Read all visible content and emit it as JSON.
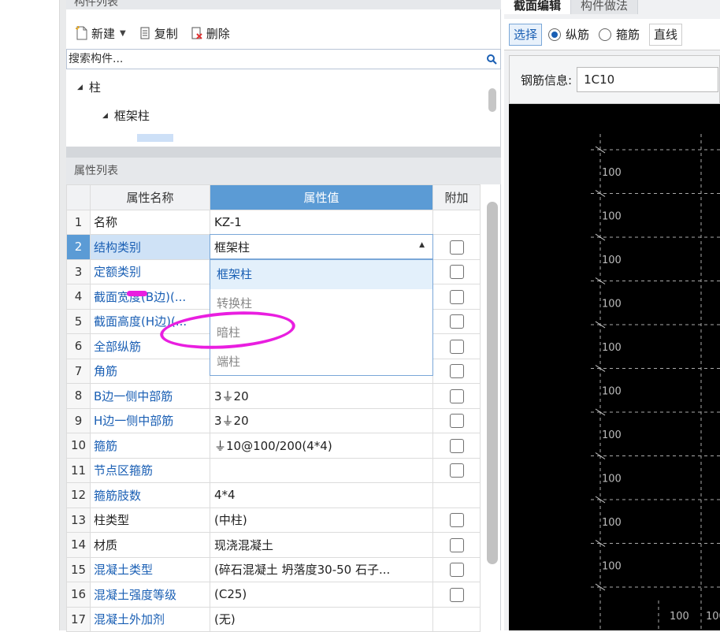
{
  "component_panel": {
    "title": "构件列表",
    "toolbar": {
      "new_label": "新建",
      "copy_label": "复制",
      "delete_label": "删除"
    },
    "search_placeholder": "搜索构件...",
    "tree": [
      {
        "label": "柱"
      },
      {
        "label": "框架柱"
      }
    ]
  },
  "property_panel": {
    "title": "属性列表",
    "headers": {
      "name": "属性名称",
      "value": "属性值",
      "extra": "附加"
    },
    "rows": [
      {
        "idx": "1",
        "name": "名称",
        "value": "KZ-1",
        "check": false
      },
      {
        "idx": "2",
        "name": "结构类别",
        "value": "框架柱",
        "check": true
      },
      {
        "idx": "3",
        "name": "定额类别",
        "value": "",
        "check": true
      },
      {
        "idx": "4",
        "name": "截面宽度(B边)(...",
        "value": "",
        "check": true
      },
      {
        "idx": "5",
        "name": "截面高度(H边)(...",
        "value": "",
        "check": true
      },
      {
        "idx": "6",
        "name": "全部纵筋",
        "value": "",
        "check": true
      },
      {
        "idx": "7",
        "name": "角筋",
        "value": "",
        "check": true
      },
      {
        "idx": "8",
        "name": "B边一侧中部筋",
        "value": "3⏚20",
        "check": true
      },
      {
        "idx": "9",
        "name": "H边一侧中部筋",
        "value": "3⏚20",
        "check": true
      },
      {
        "idx": "10",
        "name": "箍筋",
        "value": "⏚10@100/200(4*4)",
        "check": true
      },
      {
        "idx": "11",
        "name": "节点区箍筋",
        "value": "",
        "check": true
      },
      {
        "idx": "12",
        "name": "箍筋肢数",
        "value": "4*4",
        "check": false
      },
      {
        "idx": "13",
        "name": "柱类型",
        "value": "(中柱)",
        "check": true
      },
      {
        "idx": "14",
        "name": "材质",
        "value": "现浇混凝土",
        "check": true
      },
      {
        "idx": "15",
        "name": "混凝土类型",
        "value": "(碎石混凝土 坍落度30-50 石子...",
        "check": true
      },
      {
        "idx": "16",
        "name": "混凝土强度等级",
        "value": "(C25)",
        "check": true
      },
      {
        "idx": "17",
        "name": "混凝土外加剂",
        "value": "(无)",
        "check": false
      }
    ],
    "dropdown": {
      "selected": "框架柱",
      "options": [
        "框架柱",
        "转换柱",
        "暗柱",
        "端柱"
      ]
    }
  },
  "section_editor": {
    "tabs": [
      "截面编辑",
      "构件做法"
    ],
    "mode_select_label": "选择",
    "radio_longitudinal": "纵筋",
    "radio_stirrup": "箍筋",
    "line_label": "直线",
    "rebar_info_label": "钢筋信息:",
    "rebar_info_value": "1C10",
    "dim_label": "100"
  },
  "colors": {
    "accent": "#5b9bd5",
    "annotation": "#e91ee0",
    "canvas": "#000000"
  }
}
